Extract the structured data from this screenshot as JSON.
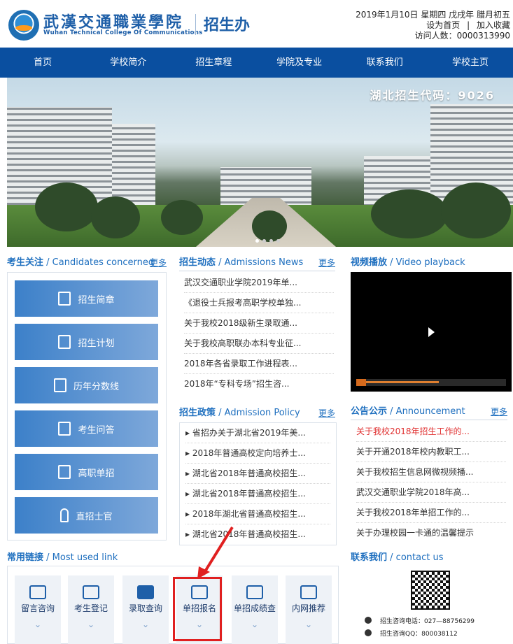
{
  "header": {
    "logo_cn": "武漢交通職業學院",
    "logo_en": "Wuhan Technical College Of Communications",
    "office": "招生办",
    "date": "2019年1月10日 星期四 戊戌年 腊月初五",
    "set_home": "设为首页",
    "separator": "|",
    "add_fav": "加入收藏",
    "visitors": "访问人数：0000313990"
  },
  "nav": [
    "首页",
    "学校简介",
    "招生章程",
    "学院及专业",
    "联系我们",
    "学校主页"
  ],
  "banner": {
    "caption": "湖北招生代码：9026"
  },
  "candidates": {
    "title_cn": "考生关注",
    "title_en": "Candidates concerned",
    "more": "更多",
    "items": [
      "招生简章",
      "招生计划",
      "历年分数线",
      "考生问答",
      "高职单招",
      "直招士官"
    ]
  },
  "news": {
    "title_cn": "招生动态",
    "title_en": "Admissions News",
    "more": "更多",
    "items": [
      "武汉交通职业学院2019年单...",
      "《退役士兵报考高职学校单独...",
      "关于我校2018级新生录取通...",
      "关于我校高职联办本科专业征...",
      "2018年各省录取工作进程表...",
      "2018年“专科专场”招生咨..."
    ]
  },
  "video": {
    "title_cn": "视频播放",
    "title_en": "Video playback",
    "progress": 0.55
  },
  "policy": {
    "title_cn": "招生政策",
    "title_en": "Admission Policy",
    "more": "更多",
    "items": [
      "省招办关于湖北省2019年美...",
      "2018年普通高校定向培养士...",
      "湖北省2018年普通高校招生...",
      "湖北省2018年普通高校招生...",
      "2018年湖北省普通高校招生...",
      "湖北省2018年普通高校招生..."
    ]
  },
  "announce": {
    "title_cn": "公告公示",
    "title_en": "Announcement",
    "more": "更多",
    "items": [
      "关于我校2018年招生工作的...",
      "关于开通2018年校内教职工...",
      "关于我校招生信息网微视频播...",
      "武汉交通职业学院2018年高...",
      "关于我校2018年单招工作的...",
      "关于办理校园一卡通的温馨提示"
    ]
  },
  "links": {
    "title_cn": "常用链接",
    "title_en": "Most used link",
    "items": [
      "留言咨询",
      "考生登记",
      "录取查询",
      "单招报名",
      "单招成绩查",
      "内网推荐"
    ]
  },
  "contact": {
    "title_cn": "联系我们",
    "title_en": "contact us",
    "phone": "招生咨询电话：027—88756299",
    "qq": "招生咨询QQ：800038112"
  },
  "colors": {
    "nav": "#0a4fa0",
    "accent": "#1e6fbf",
    "highlight": "#e02020"
  }
}
